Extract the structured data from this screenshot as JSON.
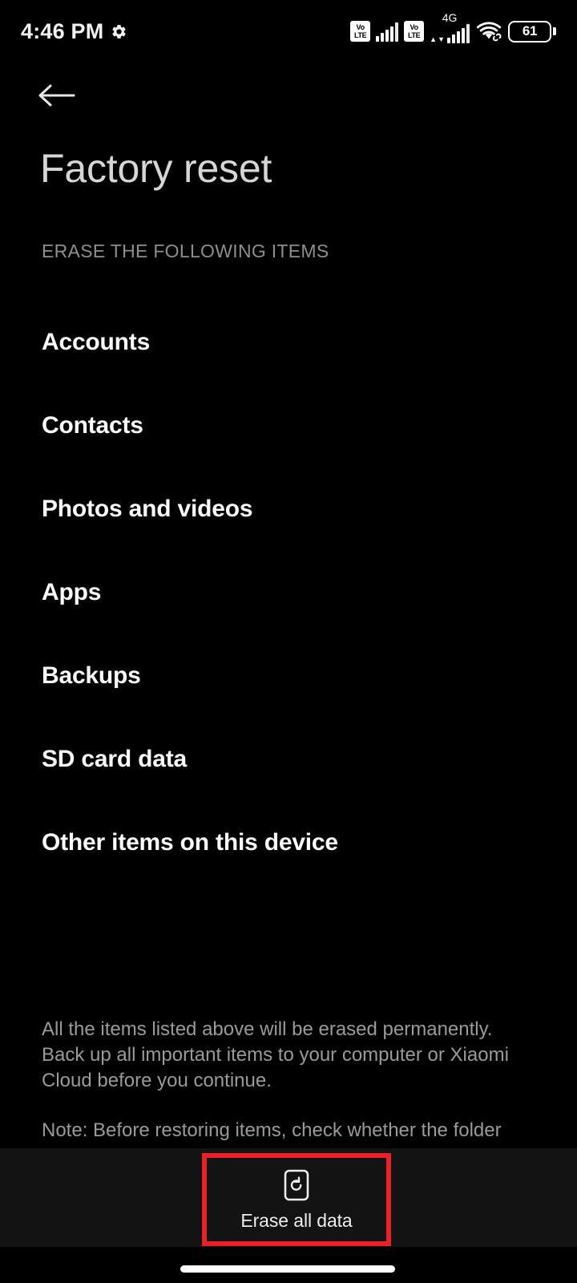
{
  "status_bar": {
    "time": "4:46 PM",
    "gear_icon": "gear-icon",
    "network_1_label": "Vo",
    "network_1_label2": "LTE",
    "network_2_label": "Vo",
    "network_2_label2": "LTE",
    "data_type": "4G",
    "wifi_icon": "wifi-icon",
    "battery_level": "61"
  },
  "header": {
    "back_icon": "back-arrow-icon",
    "title": "Factory reset"
  },
  "section": {
    "header": "ERASE THE FOLLOWING ITEMS",
    "items": [
      {
        "label": "Accounts"
      },
      {
        "label": "Contacts"
      },
      {
        "label": "Photos and videos"
      },
      {
        "label": "Apps"
      },
      {
        "label": "Backups"
      },
      {
        "label": "SD card data"
      },
      {
        "label": "Other items on this device"
      }
    ]
  },
  "footnote": {
    "paragraph_1": "All the items listed above will be erased permanently. Back up all important items to your computer or Xiaomi Cloud before you continue.",
    "paragraph_2": "Note: Before restoring items, check whether the folder"
  },
  "bottom_bar": {
    "erase_icon": "reset-device-icon",
    "erase_label": "Erase all data"
  },
  "annotation": {
    "highlight_color": "#ec2027"
  },
  "nav": {
    "home_indicator": "home-indicator"
  }
}
